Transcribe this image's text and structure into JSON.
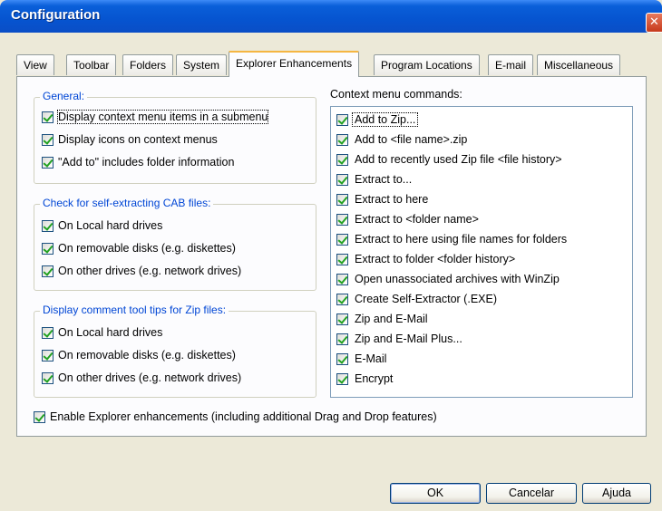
{
  "window": {
    "title": "Configuration",
    "close_glyph": "✕"
  },
  "tabs": [
    {
      "label": "View"
    },
    {
      "label": "Toolbar"
    },
    {
      "label": "Folders"
    },
    {
      "label": "System"
    },
    {
      "label": "Explorer Enhancements"
    },
    {
      "label": "Program Locations"
    },
    {
      "label": "E-mail"
    },
    {
      "label": "Miscellaneous"
    }
  ],
  "general": {
    "title": "General:",
    "items": [
      {
        "label": "Display context menu items in a submenu",
        "checked": true
      },
      {
        "label": "Display icons on context menus",
        "checked": true
      },
      {
        "label": "\"Add to\" includes folder information",
        "checked": true
      }
    ]
  },
  "cab": {
    "title": "Check for self-extracting CAB files:",
    "items": [
      {
        "label": "On Local hard drives",
        "checked": true
      },
      {
        "label": "On removable disks (e.g. diskettes)",
        "checked": true
      },
      {
        "label": "On other drives (e.g. network drives)",
        "checked": true
      }
    ]
  },
  "tooltips": {
    "title": "Display comment tool tips for Zip files:",
    "items": [
      {
        "label": "On Local hard drives",
        "checked": true
      },
      {
        "label": "On removable disks (e.g. diskettes)",
        "checked": true
      },
      {
        "label": "On other drives (e.g. network drives)",
        "checked": true
      }
    ]
  },
  "context_menu": {
    "label": "Context menu commands:",
    "items": [
      {
        "label": "Add to Zip...",
        "checked": true
      },
      {
        "label": "Add to <file name>.zip",
        "checked": true
      },
      {
        "label": "Add to recently used Zip file <file history>",
        "checked": true
      },
      {
        "label": "Extract to...",
        "checked": true
      },
      {
        "label": "Extract to here",
        "checked": true
      },
      {
        "label": "Extract to <folder name>",
        "checked": true
      },
      {
        "label": "Extract to here using file names for folders",
        "checked": true
      },
      {
        "label": "Extract to folder <folder history>",
        "checked": true
      },
      {
        "label": "Open unassociated archives with WinZip",
        "checked": true
      },
      {
        "label": "Create Self-Extractor (.EXE)",
        "checked": true
      },
      {
        "label": "Zip and E-Mail",
        "checked": true
      },
      {
        "label": "Zip and E-Mail Plus...",
        "checked": true
      },
      {
        "label": "E-Mail",
        "checked": true
      },
      {
        "label": "Encrypt",
        "checked": true
      }
    ]
  },
  "enable": {
    "label": "Enable Explorer enhancements (including additional Drag and Drop features)",
    "checked": true
  },
  "buttons": {
    "ok": "OK",
    "cancel": "Cancelar",
    "help": "Ajuda"
  }
}
